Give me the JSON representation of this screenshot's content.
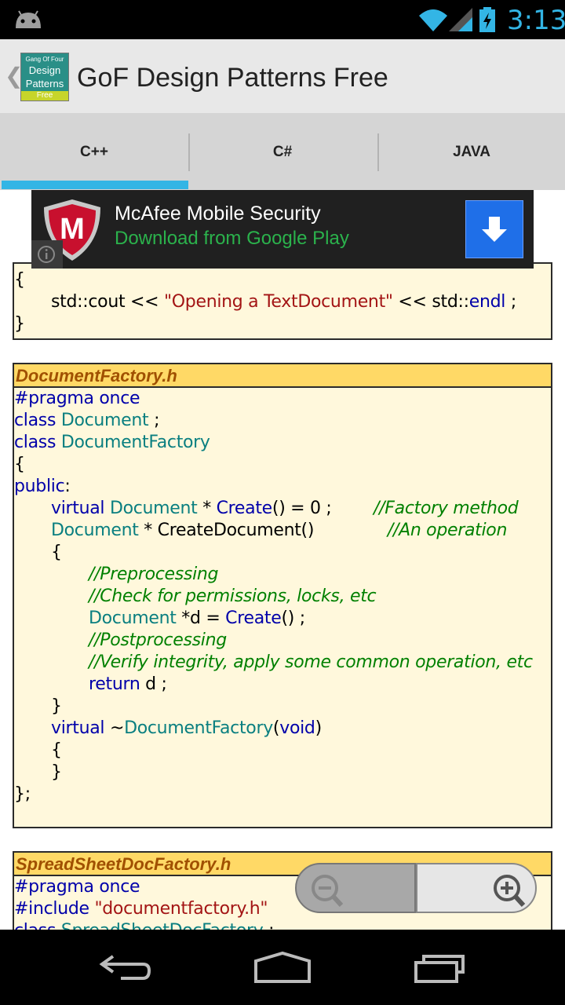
{
  "status_bar": {
    "time": "3:13"
  },
  "action_bar": {
    "title": "GoF Design Patterns Free",
    "logo": {
      "line1": "Gang Of Four",
      "line2": "Design",
      "line3": "Patterns",
      "line4": "Free"
    }
  },
  "tabs": [
    {
      "label": "C++"
    },
    {
      "label": "C#"
    },
    {
      "label": "JAVA"
    }
  ],
  "ad": {
    "title": "McAfee Mobile Security",
    "subtitle": "Download from Google Play",
    "logo_letter": "M"
  },
  "code": {
    "prev_open_brace": "{",
    "prev_cout_a": "std::cout << ",
    "prev_cout_str": "\"Opening a TextDocument\"",
    "prev_cout_b": " << std::",
    "prev_cout_endl": "endl",
    "prev_cout_c": " ;",
    "prev_close_brace": "}",
    "df_header": "DocumentFactory.h",
    "pragma": "#pragma once",
    "class_kw": "class ",
    "document": "Document",
    "semicolon": " ;",
    "document_factory": "DocumentFactory",
    "open_brace": "{",
    "public_kw": "public",
    "colon": ":",
    "virtual_kw": "virtual ",
    "star_space": " * ",
    "create": "Create",
    "create_rest": "() = 0 ;        ",
    "cm_factory": "//Factory method",
    "create_document": "CreateDocument()",
    "cd_gap": "              ",
    "cm_operation": "//An operation",
    "cm_pre": "//Preprocessing",
    "cm_check": "//Check for permissions, locks, etc",
    "d_decl": " *d = ",
    "create_call": "() ;",
    "cm_post": "//Postprocessing",
    "cm_verify": "//Verify integrity, apply some common operation, etc",
    "return_kw": "return",
    "return_rest": " d ;",
    "close_brace": "}",
    "tilde": "~",
    "paren_open": "(",
    "void_kw": "void",
    "paren_close": ")",
    "class_end": "};",
    "ss_header": "SpreadSheetDocFactory.h",
    "include_kw": "#include ",
    "include_str": "\"documentfactory.h\"",
    "ss_class": "SpreadSheetDocFactory"
  },
  "colors": {
    "accent": "#33b5e5",
    "header_bg": "#ffd966",
    "code_bg": "#fff8dc"
  }
}
